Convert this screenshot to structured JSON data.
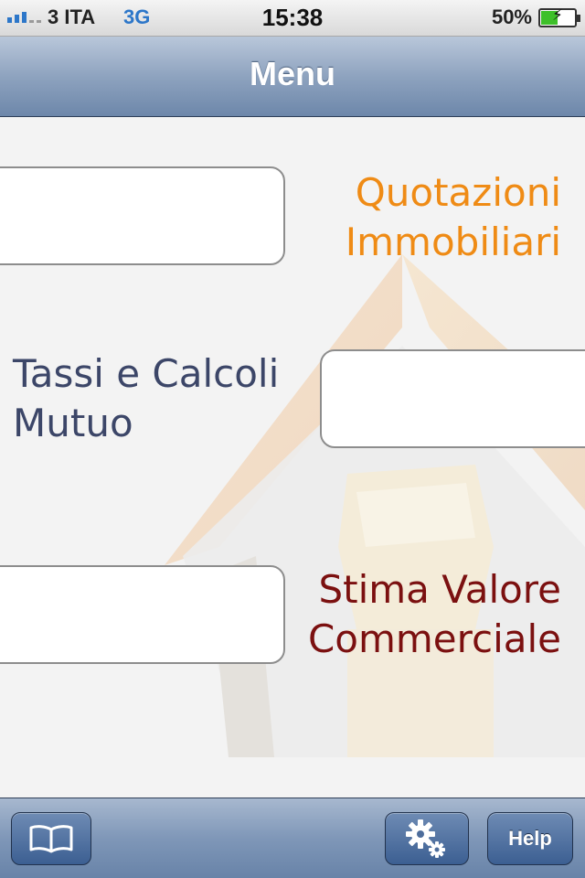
{
  "status_bar": {
    "carrier": "3 ITA",
    "network": "3G",
    "time": "15:38",
    "battery_percent": "50%",
    "battery_level": 0.5,
    "signal_bars": 3
  },
  "navbar": {
    "title": "Menu"
  },
  "menu": [
    {
      "line1": "Quotazioni",
      "line2": "Immobiliari",
      "color": "#ef8b15"
    },
    {
      "line1": "Tassi e Calcoli",
      "line2": "Mutuo",
      "color": "#3c4668"
    },
    {
      "line1": "Stima Valore",
      "line2": "Commerciale",
      "color": "#7b1010"
    }
  ],
  "toolbar": {
    "book_icon": "book-icon",
    "settings_icon": "gear-icon",
    "help_label": "Help"
  }
}
